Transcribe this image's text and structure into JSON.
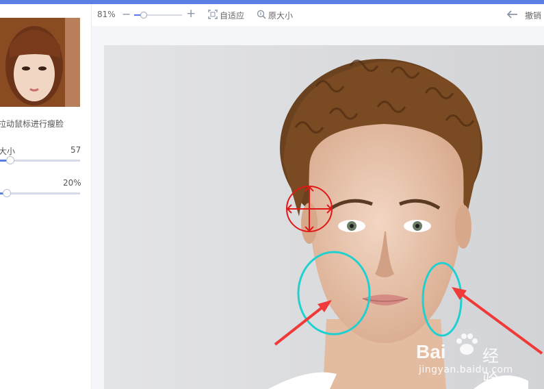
{
  "toolbar": {
    "zoom_percent": "81%",
    "zoom_minus": "−",
    "zoom_plus": "+",
    "fit_label": "自适应",
    "original_label": "原大小",
    "undo_label": "撤销"
  },
  "left_panel": {
    "hint_text": "拉动鼠标进行瘦脸",
    "size_label": "大小",
    "size_value": "57",
    "strength_value": "20%"
  },
  "watermark": {
    "brand": "Bai",
    "brand_cn": "经验",
    "url": "jingyan.baidu.com"
  },
  "colors": {
    "accent": "#5b7ee5",
    "brush_circle": "#e01818",
    "annotation_circle": "#1fd0d0",
    "annotation_arrow": "#f03a3a"
  },
  "icons": {
    "fit": "fit-window-icon",
    "original": "magnifier-icon",
    "undo": "undo-arrow-icon"
  }
}
